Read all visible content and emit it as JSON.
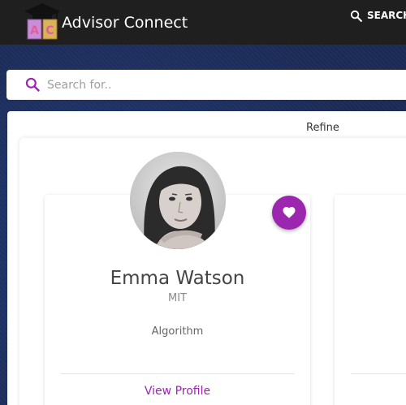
{
  "header": {
    "app_title": "Advisor Connect",
    "logo_letters": "AC",
    "search_link_label": "SEARCH"
  },
  "search": {
    "placeholder": "Search for..",
    "value": ""
  },
  "filters": {
    "refine_label": "Refine"
  },
  "advisors": [
    {
      "name": "Emma Watson",
      "school": "MIT",
      "field": "Algorithm",
      "action_label": "View Profile",
      "favorite_icon": "heart-icon"
    }
  ],
  "colors": {
    "accent": "#9b27af",
    "topbar": "#1f1f1f",
    "background": "#1b2a55"
  }
}
